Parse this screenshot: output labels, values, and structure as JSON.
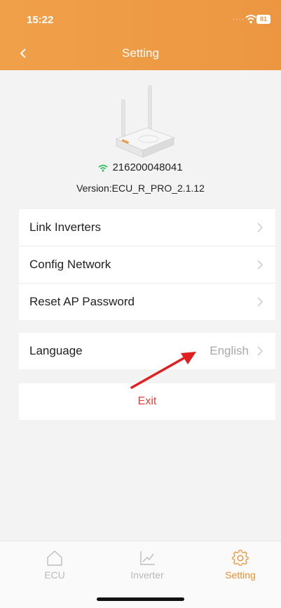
{
  "status_bar": {
    "time": "15:22",
    "battery": "81"
  },
  "header": {
    "title": "Setting"
  },
  "device": {
    "id": "216200048041",
    "version": "Version:ECU_R_PRO_2.1.12"
  },
  "menu": {
    "items": [
      {
        "label": "Link Inverters"
      },
      {
        "label": "Config Network"
      },
      {
        "label": "Reset AP Password"
      }
    ]
  },
  "language": {
    "label": "Language",
    "value": "English"
  },
  "exit": {
    "label": "Exit"
  },
  "tabbar": {
    "tabs": [
      {
        "label": "ECU",
        "icon": "home-icon"
      },
      {
        "label": "Inverter",
        "icon": "chart-icon"
      },
      {
        "label": "Setting",
        "icon": "gear-icon"
      }
    ],
    "active_tab": "Setting"
  },
  "colors": {
    "header_orange": "#ee9a44",
    "accent_active": "#ec8f2d",
    "exit_red": "#e0413a",
    "wifi_green": "#2ebd59"
  }
}
